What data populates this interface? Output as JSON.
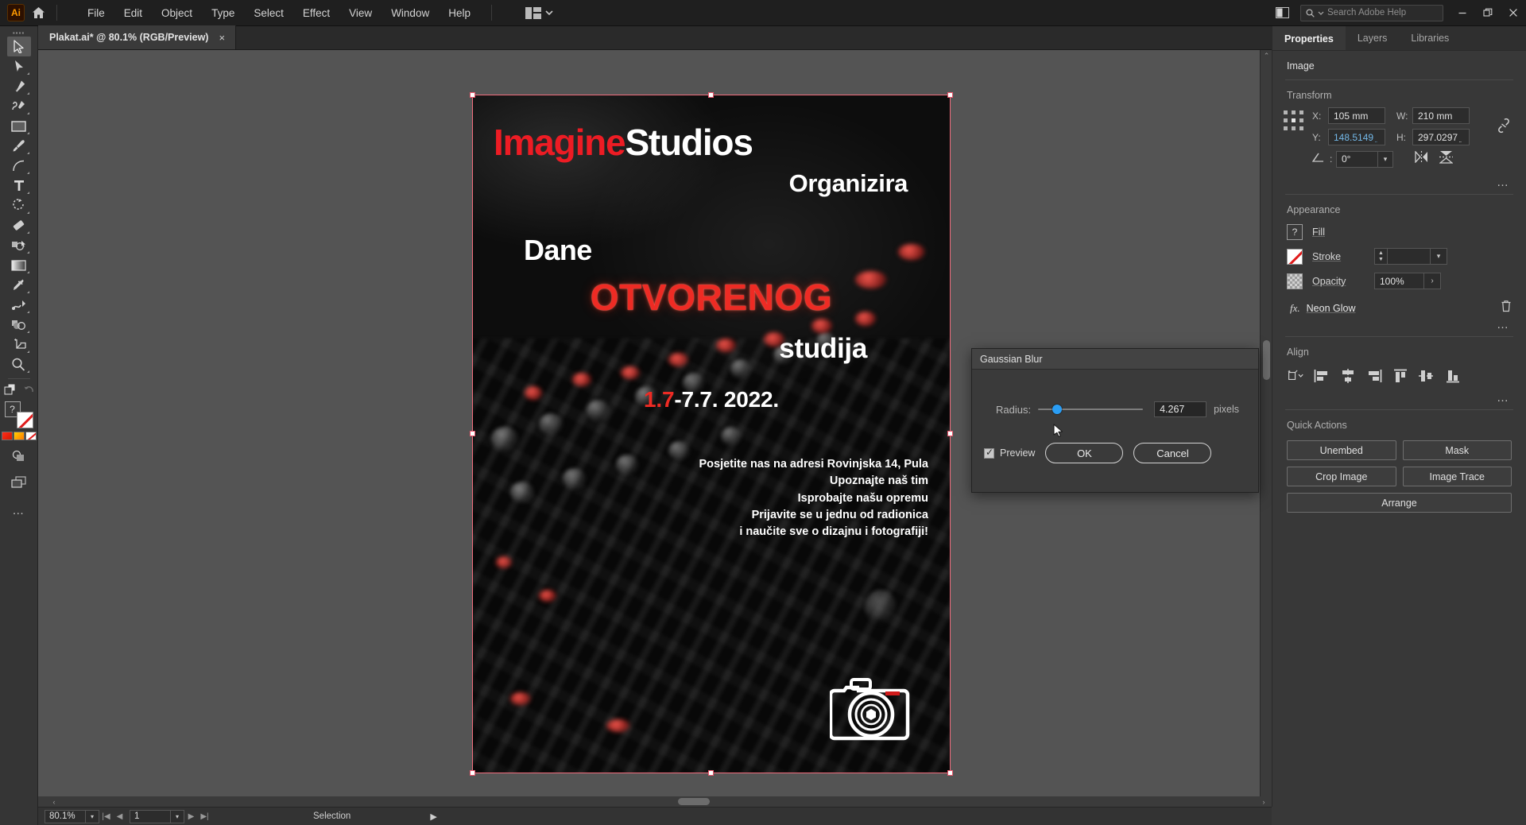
{
  "app": {
    "logo": "Ai",
    "home_icon": "home-icon"
  },
  "menubar": {
    "items": [
      "File",
      "Edit",
      "Object",
      "Type",
      "Select",
      "Effect",
      "View",
      "Window",
      "Help"
    ],
    "workspace_icon": "workspace-switcher-icon",
    "panel_toggle_icon": "panel-toggle-icon",
    "search": {
      "placeholder": "Search Adobe Help",
      "icon": "search-icon"
    },
    "window_controls": {
      "minimize": "minimize-icon",
      "restore": "restore-icon",
      "close": "close-icon"
    }
  },
  "document_tab": {
    "title": "Plakat.ai* @ 80.1% (RGB/Preview)",
    "close": "×"
  },
  "toolbar": {
    "tools": [
      {
        "name": "selection-tool",
        "active": true
      },
      {
        "name": "direct-selection-tool",
        "active": false
      },
      {
        "name": "pen-tool",
        "active": false
      },
      {
        "name": "curvature-tool",
        "active": false
      },
      {
        "name": "rectangle-tool",
        "active": false
      },
      {
        "name": "paintbrush-tool",
        "active": false
      },
      {
        "name": "arc-tool",
        "active": false
      },
      {
        "name": "type-tool",
        "active": false
      },
      {
        "name": "rotate-tool",
        "active": false
      },
      {
        "name": "eraser-tool",
        "active": false
      },
      {
        "name": "shape-builder-tool",
        "active": false
      },
      {
        "name": "gradient-tool",
        "active": false
      },
      {
        "name": "eyedropper-tool",
        "active": false
      },
      {
        "name": "blend-tool",
        "active": false
      },
      {
        "name": "symbol-sprayer-tool",
        "active": false
      },
      {
        "name": "artboard-tool",
        "active": false
      },
      {
        "name": "zoom-tool",
        "active": false
      }
    ],
    "fill_label": "?",
    "more_options": "…"
  },
  "artboard": {
    "poster": {
      "title_red": "Imagine",
      "title_white": "Studios",
      "organizira": "Organizira",
      "dane": "Dane",
      "otvorenog": "OTVORENOG",
      "studija": "studija",
      "date_red": "1.7",
      "date_white": "-7.7. 2022.",
      "body_lines": [
        "Posjetite nas na adresi Rovinjska 14, Pula",
        "Upoznajte naš tim",
        "Isprobajte našu opremu",
        "Prijavite se u jednu od radionica",
        "i naučite sve o dizajnu i fotografiji!"
      ],
      "camera_icon": "camera-icon"
    },
    "selection_color": "#f26d7d"
  },
  "dialog": {
    "title": "Gaussian Blur",
    "radius_label": "Radius:",
    "radius_value": "4.267",
    "unit": "pixels",
    "preview_label": "Preview",
    "preview_checked": true,
    "ok_label": "OK",
    "cancel_label": "Cancel",
    "slider_accent": "#2a9df4"
  },
  "properties_panel": {
    "tabs": [
      {
        "label": "Properties",
        "active": true
      },
      {
        "label": "Layers",
        "active": false
      },
      {
        "label": "Libraries",
        "active": false
      }
    ],
    "object_type": "Image",
    "transform": {
      "title": "Transform",
      "x_label": "X:",
      "x_value": "105 mm",
      "y_label": "Y:",
      "y_value": "148.5149 ֵ",
      "w_label": "W:",
      "w_value": "210 mm",
      "h_label": "H:",
      "h_value": "297.0297 ֵ",
      "angle_label": "angle-icon",
      "angle_value": "0°",
      "link_icon": "link-broken-icon",
      "flip_h_icon": "flip-horizontal-icon",
      "flip_v_icon": "flip-vertical-icon",
      "more": "…"
    },
    "appearance": {
      "title": "Appearance",
      "fill_label": "Fill",
      "fill_swatch": "question-mark-swatch",
      "stroke_label": "Stroke",
      "stroke_swatch": "none-swatch",
      "stroke_value": "",
      "opacity_label": "Opacity",
      "opacity_value": "100%",
      "effect_icon": "fx-icon",
      "effect_name": "Neon Glow",
      "delete_icon": "trash-icon",
      "more": "…"
    },
    "align": {
      "title": "Align",
      "buttons": [
        "align-to-selection-icon",
        "align-left-icon",
        "align-horizontal-center-icon",
        "align-right-icon",
        "align-top-icon",
        "align-vertical-center-icon",
        "align-bottom-icon"
      ],
      "more": "…"
    },
    "quick_actions": {
      "title": "Quick Actions",
      "buttons": [
        "Unembed",
        "Mask",
        "Crop Image",
        "Image Trace",
        "Arrange"
      ]
    }
  },
  "statusbar": {
    "zoom": "80.1%",
    "page": "1",
    "tool_status": "Selection",
    "first_icon": "first-page-icon",
    "prev_icon": "prev-page-icon",
    "next_icon": "next-page-icon",
    "last_icon": "last-page-icon",
    "play_icon": "play-icon"
  }
}
